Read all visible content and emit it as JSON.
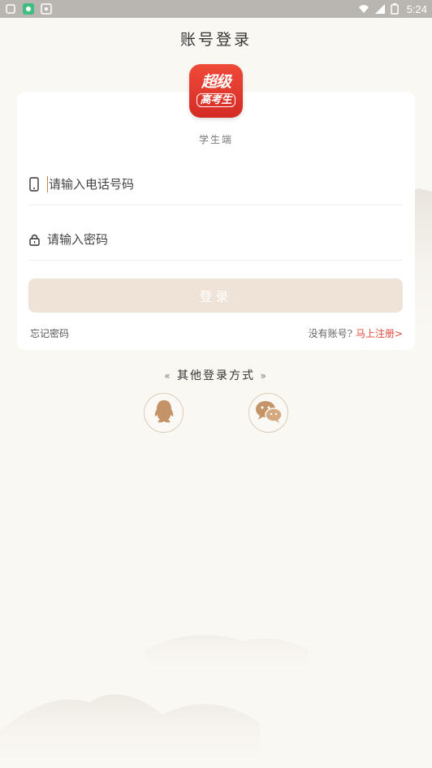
{
  "status_bar": {
    "time": "5:24"
  },
  "header": {
    "title": "账号登录"
  },
  "app": {
    "logo_line1": "超级",
    "logo_line2": "高考生",
    "subtitle": "学生端"
  },
  "form": {
    "phone_placeholder": "请输入电话号码",
    "password_placeholder": "请输入密码",
    "login_label": "登录",
    "forgot_label": "忘记密码",
    "no_account_label": "没有账号?",
    "register_label": "马上注册>"
  },
  "other_login": {
    "title": "其他登录方式",
    "left_chev": "«",
    "right_chev": "»"
  },
  "colors": {
    "brand_red": "#e0463b",
    "button_bg": "#efe3d8",
    "page_bg": "#faf8f3",
    "accent_gold": "#c5853c"
  }
}
